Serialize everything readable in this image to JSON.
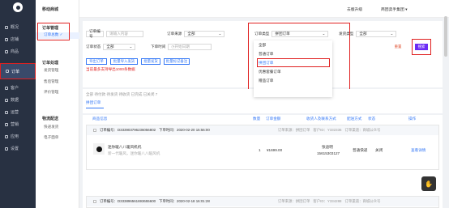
{
  "sidebar": {
    "items": [
      {
        "label": "概况"
      },
      {
        "label": "店铺"
      },
      {
        "label": "商品"
      },
      {
        "label": "订单"
      },
      {
        "label": "客户"
      },
      {
        "label": "数据"
      },
      {
        "label": "运营"
      },
      {
        "label": "营销"
      },
      {
        "label": "应用"
      },
      {
        "label": "设置"
      }
    ]
  },
  "submenu": {
    "title": "移动商城",
    "groups": [
      {
        "title": "订单管理",
        "items": [
          "订单总数 ✓"
        ]
      },
      {
        "title": "订单处理",
        "items": [
          "发货管理",
          "售后管理",
          "评价管理"
        ]
      },
      {
        "title": "物流配送",
        "items": [
          "快递发货",
          "电子面单"
        ]
      }
    ]
  },
  "topbar": {
    "upgrade": "去版升级",
    "account": "商团卖手集团 ▾"
  },
  "filters": {
    "order_no_label": "订单编号",
    "order_no_placeholder": "请输入内容",
    "source_label": "订单来源",
    "source_value": "全部",
    "type_label": "订单类型",
    "type_value": "拼团订单",
    "ship_label": "发货类型",
    "ship_value": "全部",
    "status_label": "订单状态",
    "status_value": "全部",
    "time_label": "下单时间",
    "time_start": "开始日期",
    "reset": "重置",
    "search": "搜索"
  },
  "actions": {
    "export": "导出订单",
    "batch_import": "批量导入发货",
    "batch_ship": "批量发货",
    "batch_remark": "批量标记备注",
    "tip": "当前最多支持导出1000条数据"
  },
  "dropdown": {
    "options": [
      "全部",
      "普通订单",
      "拼团订单",
      "优惠套餐订单",
      "赠品订单"
    ],
    "selected": "拼团订单"
  },
  "tabs": {
    "status_line": "全部   待付款   待发货   待收货   已完成   已关闭   7",
    "active": "拼团订单"
  },
  "table": {
    "headers": [
      "商品信息",
      "数量",
      "订单金额",
      "收货人及联系方式",
      "配送方式",
      "状态",
      "操作"
    ]
  },
  "orders": [
    {
      "order_no": "订单编号：D333903796236056802",
      "time": "下单时间：2020-02-20 15:56:00",
      "origin": "订单来源：拼团订单",
      "account": "客户ID：Y332336",
      "shop": "订单渠道：商城公众号",
      "product": "迷你暖八八暖风机机",
      "spec": "新一代暖风，迷你暖八八暖风机",
      "qty": "1",
      "amount": "¥1699.00",
      "receiver": "张迪明",
      "phone": "15615303127",
      "ship": "普通快递",
      "status": "关闭",
      "op": "查看详情"
    },
    {
      "order_no": "订单编号：D333896561693655600",
      "time": "下单时间：2020-02-18 16:01:28",
      "origin": "订单来源：拼团订单",
      "account": "客户ID：Y334288",
      "shop": "订单渠道：商城公众号"
    }
  ]
}
